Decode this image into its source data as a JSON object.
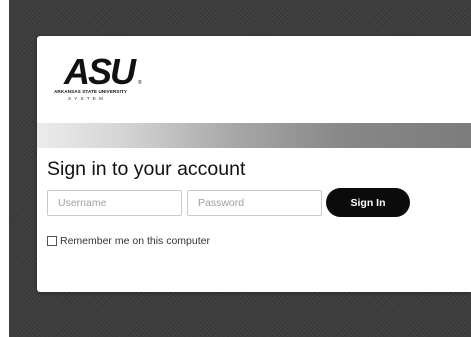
{
  "logo": {
    "letters": "ASU",
    "trademark": "®",
    "subtitle": "ARKANSAS STATE UNIVERSITY",
    "system": "SYSTEM"
  },
  "login": {
    "title": "Sign in to your account",
    "username_placeholder": "Username",
    "password_placeholder": "Password",
    "submit_label": "Sign In",
    "remember_label": "Remember me on this computer",
    "remember_checked": false
  },
  "colors": {
    "button": "#0b0b0b",
    "banner_start": "#ececec",
    "banner_end": "#7c7c7c",
    "background": "#3d3d3d"
  }
}
